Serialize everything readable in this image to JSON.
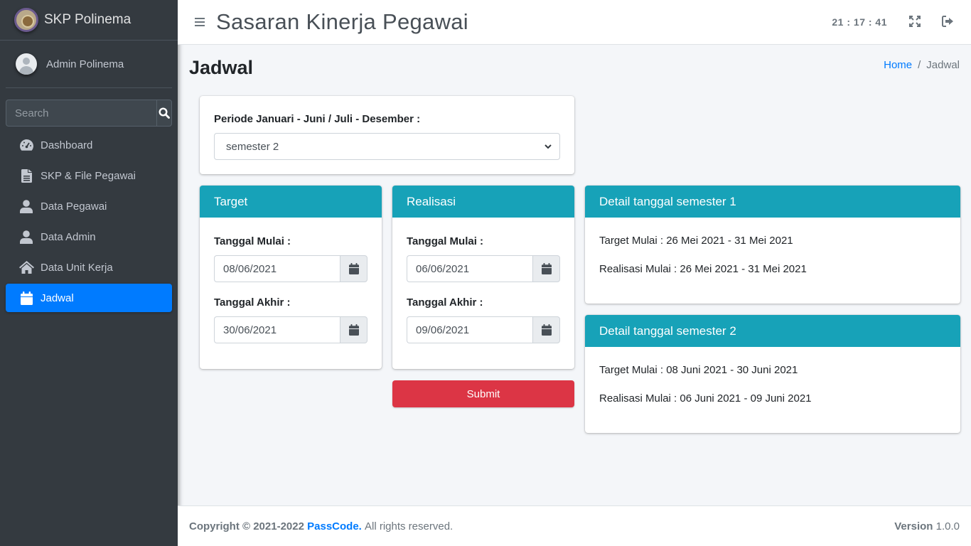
{
  "brand": {
    "name": "SKP Polinema",
    "logo_icon": "polinema-logo"
  },
  "user": {
    "name": "Admin Polinema"
  },
  "search": {
    "placeholder": "Search"
  },
  "sidebar": {
    "items": [
      {
        "label": "Dashboard",
        "icon": "tachometer-icon",
        "active": false
      },
      {
        "label": "SKP & File Pegawai",
        "icon": "file-icon",
        "active": false
      },
      {
        "label": "Data Pegawai",
        "icon": "user-icon",
        "active": false
      },
      {
        "label": "Data Admin",
        "icon": "user-icon",
        "active": false
      },
      {
        "label": "Data Unit Kerja",
        "icon": "home-icon",
        "active": false
      },
      {
        "label": "Jadwal",
        "icon": "calendar-icon",
        "active": true
      }
    ]
  },
  "header": {
    "title": "Sasaran Kinerja Pegawai",
    "clock": "21 : 17 : 41"
  },
  "page": {
    "title": "Jadwal"
  },
  "breadcrumb": {
    "home": "Home",
    "separator": "/",
    "current": "Jadwal"
  },
  "period": {
    "label": "Periode Januari - Juni / Juli - Desember :",
    "selected": "semester 2"
  },
  "target": {
    "title": "Target",
    "start_label": "Tanggal Mulai :",
    "start_value": "08/06/2021",
    "end_label": "Tanggal Akhir :",
    "end_value": "30/06/2021"
  },
  "realisasi": {
    "title": "Realisasi",
    "start_label": "Tanggal Mulai :",
    "start_value": "06/06/2021",
    "end_label": "Tanggal Akhir :",
    "end_value": "09/06/2021"
  },
  "submit": {
    "label": "Submit"
  },
  "detail1": {
    "title": "Detail tanggal semester 1",
    "target": "Target Mulai : 26 Mei 2021 - 31 Mei 2021",
    "realisasi": "Realisasi Mulai : 26 Mei 2021 - 31 Mei 2021"
  },
  "detail2": {
    "title": "Detail tanggal semester 2",
    "target": "Target Mulai : 08 Juni 2021 - 30 Juni 2021",
    "realisasi": "Realisasi Mulai : 06 Juni 2021 - 09 Juni 2021"
  },
  "footer": {
    "copyright": "Copyright © 2021-2022",
    "company": "PassCode.",
    "rights": "All rights reserved.",
    "version_label": "Version",
    "version": "1.0.0"
  },
  "colors": {
    "sidebar": "#343a40",
    "active": "#007bff",
    "card_header": "#17a2b8",
    "submit": "#dc3545"
  }
}
